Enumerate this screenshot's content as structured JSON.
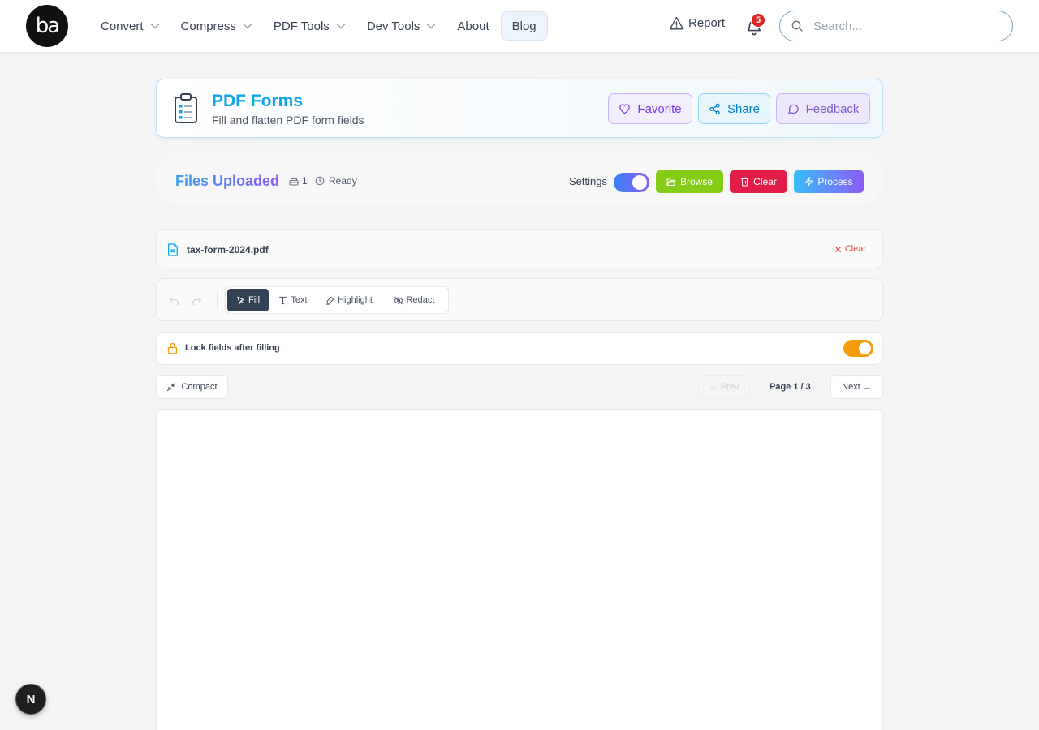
{
  "header": {
    "logo_text": "ba",
    "nav": [
      {
        "label": "Convert",
        "has_dropdown": true
      },
      {
        "label": "Compress",
        "has_dropdown": true
      },
      {
        "label": "PDF Tools",
        "has_dropdown": true
      },
      {
        "label": "Dev Tools",
        "has_dropdown": true
      },
      {
        "label": "About",
        "has_dropdown": false
      },
      {
        "label": "Blog",
        "has_dropdown": false
      }
    ],
    "report_label": "Report",
    "notification_count": "5",
    "search_placeholder": "Search..."
  },
  "tool": {
    "title": "PDF Forms",
    "subtitle": "Fill and flatten PDF form fields",
    "favorite_label": "Favorite",
    "share_label": "Share",
    "feedback_label": "Feedback"
  },
  "files": {
    "title": "Files Uploaded",
    "count": "1",
    "status": "Ready",
    "settings_label": "Settings",
    "settings_enabled": true,
    "browse_label": "Browse",
    "clear_label": "Clear",
    "process_label": "Process"
  },
  "file": {
    "name": "tax-form-2024.pdf",
    "clear_label": "Clear"
  },
  "toolbar": {
    "tools": [
      {
        "label": "Fill",
        "icon": "cursor-icon",
        "active": true
      },
      {
        "label": "Text",
        "icon": "text-icon",
        "active": false
      },
      {
        "label": "Highlight",
        "icon": "highlighter-icon",
        "active": false
      },
      {
        "label": "Redact",
        "icon": "eye-off-icon",
        "active": false
      }
    ]
  },
  "lock": {
    "label": "Lock fields after filling",
    "enabled": true
  },
  "pagination": {
    "compact_label": "Compact",
    "prev_label": "← Prev",
    "page_label": "Page 1 / 3",
    "next_label": "Next →"
  },
  "fab_label": "N",
  "colors": {
    "accent_sky": "#0ea5e9",
    "browse_green": "#84cc16",
    "clear_red": "#e11d48",
    "lock_toggle": "#f59e0b",
    "active_tool": "#334155"
  }
}
